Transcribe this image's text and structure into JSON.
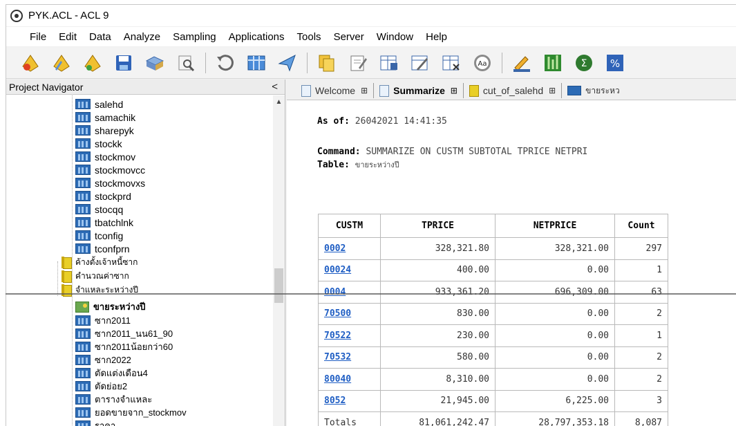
{
  "window": {
    "title": "PYK.ACL - ACL 9"
  },
  "menu": [
    "File",
    "Edit",
    "Data",
    "Analyze",
    "Sampling",
    "Applications",
    "Tools",
    "Server",
    "Window",
    "Help"
  ],
  "navigator": {
    "title": "Project Navigator",
    "collapse_glyph": "<",
    "tables_top": [
      "salehd",
      "samachik",
      "sharepyk",
      "stockk",
      "stockmov",
      "stockmovcc",
      "stockmovxs",
      "stockprd",
      "stocqq",
      "tbatchlnk",
      "tconfig",
      "tconfprn"
    ],
    "folders": [
      "ค้างตั้งเจ้าหนี้ซาก",
      "คำนวณค่าซาก",
      "จำแหละระหว่างปี"
    ],
    "selected_item": "ขายระหว่างปี",
    "tables_bottom": [
      "ซาก2011",
      "ซาก2011_นน61_90",
      "ซาก2011น้อยกว่า60",
      "ซาก2022",
      "ตัดแต่งเดือน4",
      "ตัดย่อย2",
      "ตารางจำแหละ",
      "ยอดขายจาก_stockmov",
      "ราคา"
    ]
  },
  "tabs": [
    {
      "label": "Welcome",
      "icon": "document-icon",
      "active": false
    },
    {
      "label": "Summarize",
      "icon": "document-icon",
      "active": true
    },
    {
      "label": "cut_of_salehd",
      "icon": "folder-icon",
      "active": false
    },
    {
      "label": "ขายระหว",
      "icon": "table-icon",
      "active": false
    }
  ],
  "report": {
    "as_of_label": "As of:",
    "as_of_value": "26042021 14:41:35",
    "command_label": "Command:",
    "command_value": "SUMMARIZE ON CUSTM SUBTOTAL TPRICE NETPRI",
    "table_label": "Table:",
    "table_value": "ขายระหว่างปี"
  },
  "results": {
    "headers": [
      "CUSTM",
      "TPRICE",
      "NETPRICE",
      "Count"
    ],
    "rows": [
      {
        "custm": "0002",
        "tprice": "328,321.80",
        "netprice": "328,321.00",
        "count": "297"
      },
      {
        "custm": "00024",
        "tprice": "400.00",
        "netprice": "0.00",
        "count": "1"
      },
      {
        "custm": "0004",
        "tprice": "933,361.20",
        "netprice": "696,309.00",
        "count": "63"
      },
      {
        "custm": "70500",
        "tprice": "830.00",
        "netprice": "0.00",
        "count": "2"
      },
      {
        "custm": "70522",
        "tprice": "230.00",
        "netprice": "0.00",
        "count": "1"
      },
      {
        "custm": "70532",
        "tprice": "580.00",
        "netprice": "0.00",
        "count": "2"
      },
      {
        "custm": "80040",
        "tprice": "8,310.00",
        "netprice": "0.00",
        "count": "2"
      },
      {
        "custm": "8052",
        "tprice": "21,945.00",
        "netprice": "6,225.00",
        "count": "3"
      }
    ],
    "totals": {
      "label": "Totals",
      "tprice": "81,061,242.47",
      "netprice": "28,797,353.18",
      "count": "8,087"
    }
  }
}
